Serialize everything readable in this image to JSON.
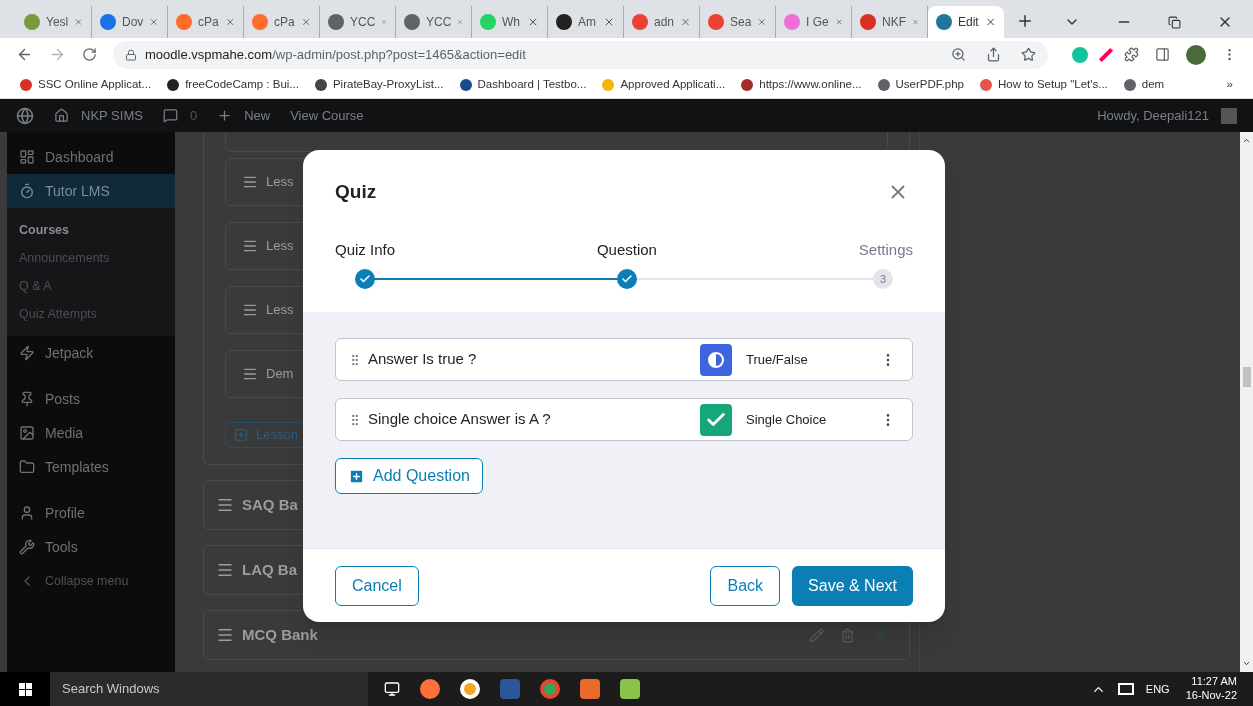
{
  "browser": {
    "tabs": [
      {
        "title": "Yesl",
        "selected": false,
        "color": "#7a9a3a"
      },
      {
        "title": "Dov",
        "selected": false,
        "color": "#1a73e8"
      },
      {
        "title": "cPa",
        "selected": false,
        "color": "#ff6c2c"
      },
      {
        "title": "cPa",
        "selected": false,
        "color": "#ff6c2c"
      },
      {
        "title": "YCC",
        "selected": false,
        "color": "#5f6368"
      },
      {
        "title": "YCC",
        "selected": false,
        "color": "#5f6368"
      },
      {
        "title": "Wh",
        "selected": false,
        "color": "#25d366"
      },
      {
        "title": "Am",
        "selected": false,
        "color": "#222222"
      },
      {
        "title": "adn",
        "selected": false,
        "color": "#ea4335"
      },
      {
        "title": "Sea",
        "selected": false,
        "color": "#ea4335"
      },
      {
        "title": "I Ge",
        "selected": false,
        "color": "#f06ed8"
      },
      {
        "title": "NKF",
        "selected": false,
        "color": "#d93025"
      },
      {
        "title": "Edit",
        "selected": true,
        "color": "#21759b"
      }
    ],
    "address": {
      "host": "moodle.vspmahe.com",
      "path": "/wp-admin/post.php?post=1465&action=edit"
    },
    "bookmarks": [
      {
        "title": "SSC Online Applicat...",
        "color": "#d93025"
      },
      {
        "title": "freeCodeCamp : Bui...",
        "color": "#222222"
      },
      {
        "title": "PirateBay-ProxyList...",
        "color": "#444444"
      },
      {
        "title": "Dashboard | Testbo...",
        "color": "#1a4b8c"
      },
      {
        "title": "Approved Applicati...",
        "color": "#f4b400"
      },
      {
        "title": "https://www.online...",
        "color": "#a52a2a"
      },
      {
        "title": "UserPDF.php",
        "color": "#5f6368"
      },
      {
        "title": "How to Setup \"Let's...",
        "color": "#e5534b"
      },
      {
        "title": "dem",
        "color": "#5f6368"
      }
    ],
    "bookmarks_more": "»"
  },
  "admin_bar": {
    "site": "NKP SIMS",
    "comments": "0",
    "new": "New",
    "view": "View Course",
    "howdy": "Howdy, Deepali121"
  },
  "sidebar": {
    "items": [
      {
        "label": "Dashboard",
        "selected": false
      },
      {
        "label": "Tutor LMS",
        "selected": true,
        "children": [
          {
            "label": "Courses",
            "selected": true
          },
          {
            "label": "Announcements",
            "selected": false
          },
          {
            "label": "Q & A",
            "selected": false
          },
          {
            "label": "Quiz Attempts",
            "selected": false
          }
        ]
      },
      {
        "label": "Jetpack",
        "selected": false
      },
      {
        "label": "Posts",
        "selected": false
      },
      {
        "label": "Media",
        "selected": false
      },
      {
        "label": "Templates",
        "selected": false
      },
      {
        "label": "Profile",
        "selected": false
      },
      {
        "label": "Tools",
        "selected": false
      },
      {
        "label": "Collapse menu",
        "selected": false
      }
    ]
  },
  "background": {
    "lessons": [
      "Less",
      "Less",
      "Less",
      "Dem"
    ],
    "add_lesson": "Lesson",
    "topics": [
      "SAQ Ba",
      "LAQ Ba",
      "MCQ Bank"
    ]
  },
  "modal": {
    "title": "Quiz",
    "steps": [
      {
        "label": "Quiz Info",
        "done": true
      },
      {
        "label": "Question",
        "done": true
      },
      {
        "label": "Settings",
        "done": false,
        "number": "3"
      }
    ],
    "questions": [
      {
        "title": "Answer Is true ?",
        "type": "True/False",
        "kind": "true_false"
      },
      {
        "title": "Single choice Answer is A ?",
        "type": "Single Choice",
        "kind": "single_choice"
      }
    ],
    "add_question": "Add Question",
    "cancel": "Cancel",
    "back": "Back",
    "next": "Save & Next"
  },
  "taskbar": {
    "search": "Search Windows",
    "language": "ENG",
    "time": "11:27 AM",
    "date": "16-Nov-22"
  }
}
